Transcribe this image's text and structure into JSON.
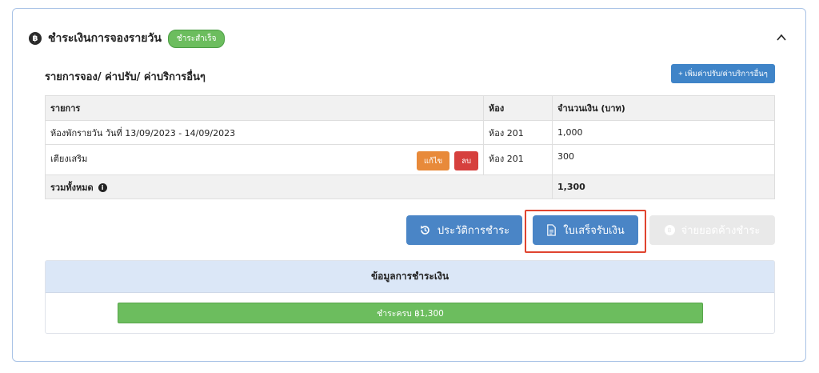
{
  "card": {
    "title": "ชำระเงินการจองรายวัน",
    "status_badge": "ชำระสำเร็จ",
    "currency_symbol": "฿"
  },
  "section": {
    "label": "รายการจอง/ ค่าปรับ/ ค่าบริการอื่นๆ",
    "add_button": "+ เพิ่มค่าปรับ/ค่าบริการอื่นๆ"
  },
  "table": {
    "headers": [
      "รายการ",
      "ห้อง",
      "จำนวนเงิน (บาท)"
    ],
    "rows": [
      {
        "item": "ห้องพักรายวัน วันที่ 13/09/2023 - 14/09/2023",
        "room": "ห้อง 201",
        "amount": "1,000"
      },
      {
        "item": "เตียงเสริม",
        "room": "ห้อง 201",
        "amount": "300",
        "edit_label": "แก้ไข",
        "delete_label": "ลบ"
      }
    ],
    "total_label": "รวมทั้งหมด",
    "total_amount": "1,300"
  },
  "actions": {
    "history_label": "ประวัติการชำระ",
    "receipt_label": "ใบเสร็จรับเงิน",
    "pay_outstanding_label": "จ่ายยอดค้างชำระ"
  },
  "payment_info": {
    "title": "ข้อมูลการชำระเงิน",
    "paid_bar_label": "ชำระครบ ฿1,300",
    "paid_fraction": 1.0
  },
  "colors": {
    "primary": "#4a85c6",
    "success": "#6cbd5e",
    "danger": "#d6403d",
    "warning": "#e88a3a",
    "highlight": "#e0442f"
  }
}
